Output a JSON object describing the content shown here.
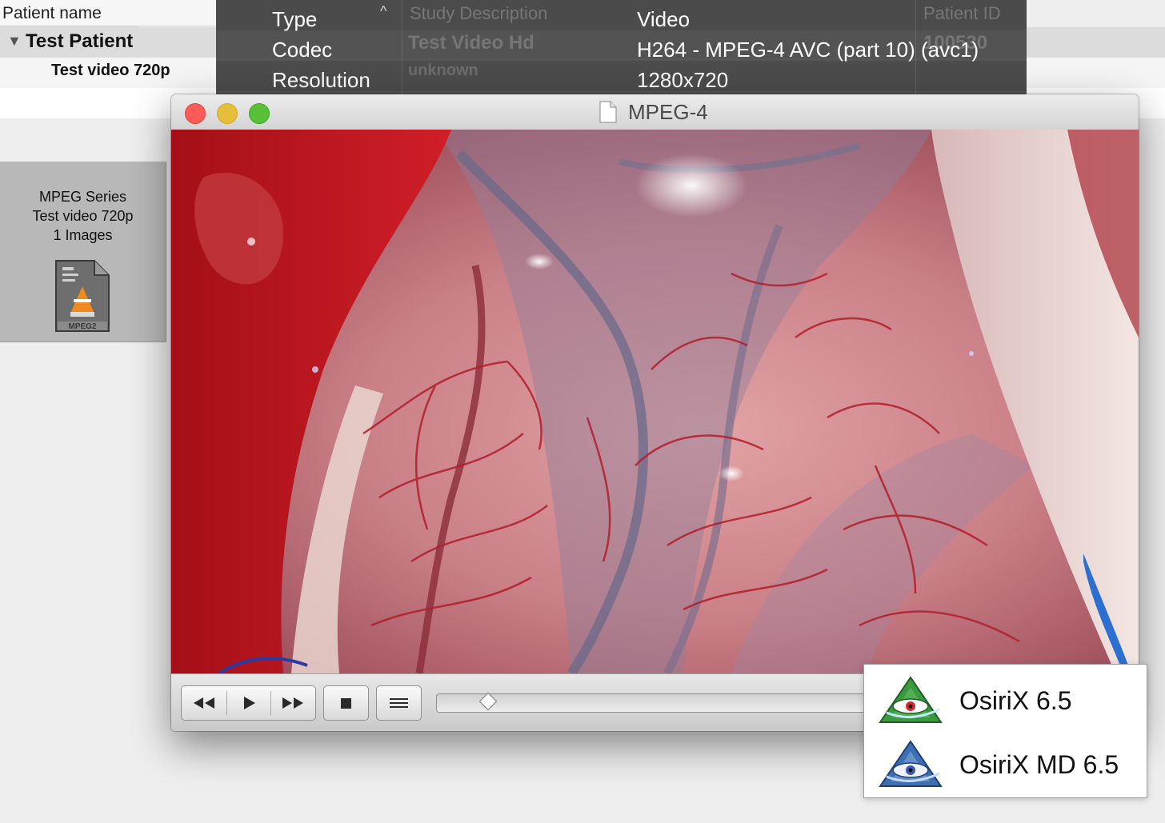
{
  "browser": {
    "header_patient_name": "Patient name",
    "patient_row": {
      "expand_glyph": "▼",
      "name": "Test Patient"
    },
    "study_row": {
      "name": "Test video 720p"
    },
    "series_tile": {
      "line1": "MPEG Series",
      "line2": "Test video 720p",
      "line3": "1 Images",
      "thumb_label": "MPEG2"
    }
  },
  "info_hud": {
    "rows": [
      {
        "key": "Type",
        "value": "Video"
      },
      {
        "key": "Codec",
        "value": "H264 - MPEG-4 AVC (part 10) (avc1)"
      },
      {
        "key": "Resolution",
        "value": "1280x720"
      }
    ],
    "behind": {
      "study_description_header": "Study Description",
      "patient_id_header": "Patient ID",
      "study_description_value": "Test Video Hd",
      "patient_id_value": "100530",
      "unknown_value": "unknown",
      "sort_glyph": "^"
    }
  },
  "player": {
    "title": "MPEG-4",
    "controls": {
      "rewind_icon": "rewind-icon",
      "play_icon": "play-icon",
      "fast_forward_icon": "fast-forward-icon",
      "stop_icon": "stop-icon",
      "playlist_icon": "playlist-icon"
    },
    "playback_progress": 0.04
  },
  "launcher": {
    "items": [
      {
        "label": "OsiriX 6.5",
        "icon": "osirix-icon",
        "color": "#3a9a3e"
      },
      {
        "label": "OsiriX MD 6.5",
        "icon": "osirix-md-icon",
        "color": "#3c6fb4"
      }
    ]
  },
  "colors": {
    "close": "#fc5b57",
    "minimize": "#e5bf3c",
    "maximize": "#57c038",
    "hud_background": "#484848"
  }
}
